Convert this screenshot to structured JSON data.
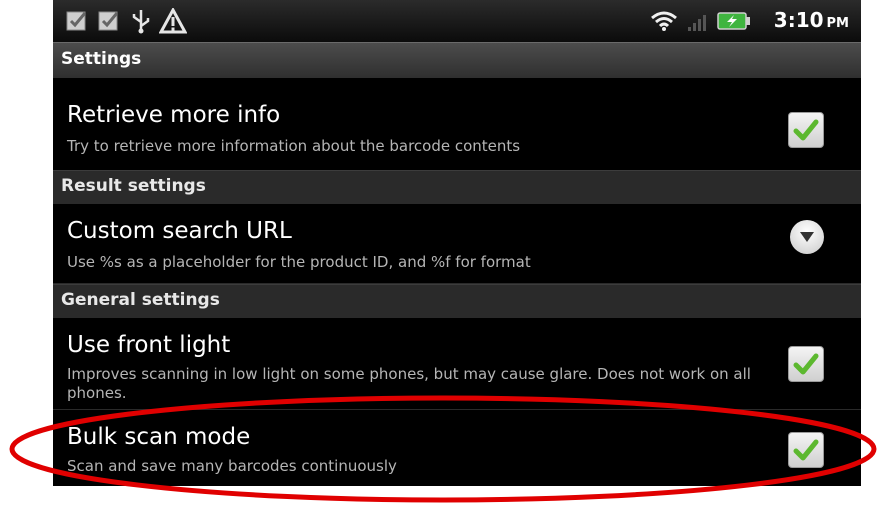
{
  "status_bar": {
    "icons": [
      "checkbox-notification-icon",
      "checkbox-notification-icon",
      "usb-icon",
      "warning-icon",
      "wifi-icon",
      "signal-icon",
      "battery-charging-icon"
    ],
    "time": "3:10",
    "ampm": "PM"
  },
  "title": "Settings",
  "prefs": {
    "retrieve": {
      "title": "Retrieve more info",
      "summary": "Try to retrieve more information about the barcode contents",
      "checked": true
    },
    "result_category": "Result settings",
    "custom_url": {
      "title": "Custom search URL",
      "summary": "Use %s as a placeholder for the product ID, and %f for format"
    },
    "general_category": "General settings",
    "front_light": {
      "title": "Use front light",
      "summary": "Improves scanning in low light on some phones, but may cause glare. Does not work on all phones.",
      "checked": true
    },
    "bulk_scan": {
      "title": "Bulk scan mode",
      "summary": "Scan and save many barcodes continuously",
      "checked": true
    }
  },
  "colors": {
    "check": "#5cb82f",
    "highlight": "#e00000"
  }
}
